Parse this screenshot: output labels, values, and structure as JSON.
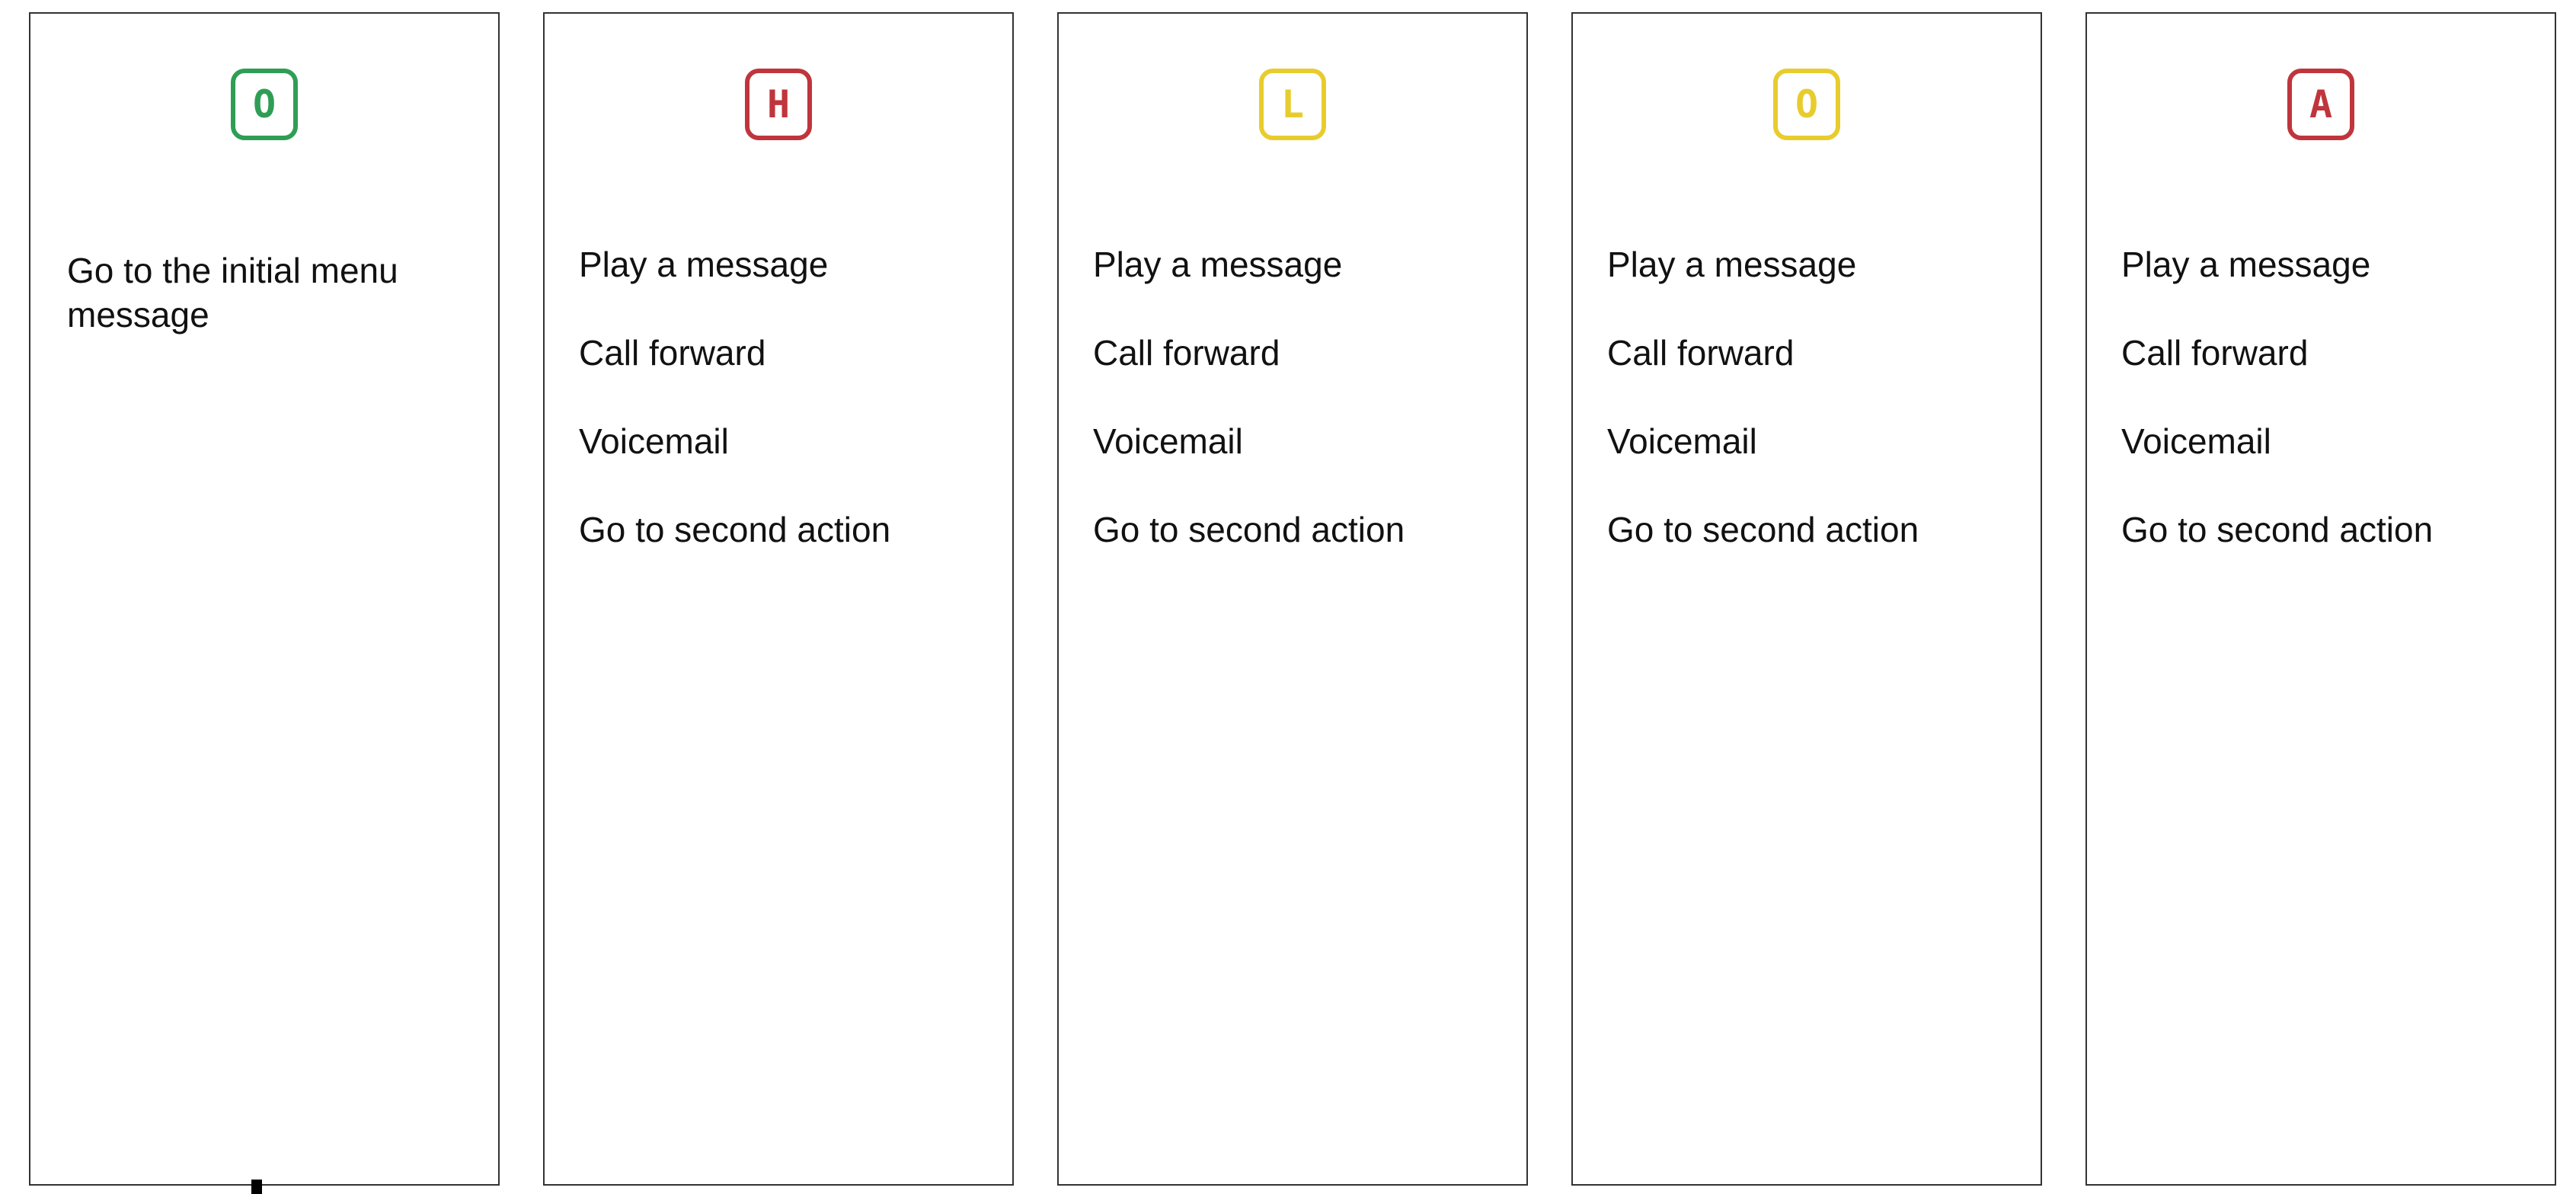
{
  "panels": [
    {
      "badge": {
        "letter": "O",
        "color": "#2f9e55"
      },
      "actions": [
        "Go to the initial menu message"
      ]
    },
    {
      "badge": {
        "letter": "H",
        "color": "#c0353c"
      },
      "actions": [
        "Play a message",
        "Call forward",
        "Voicemail",
        "Go to second action"
      ]
    },
    {
      "badge": {
        "letter": "L",
        "color": "#e8cc2e"
      },
      "actions": [
        "Play a message",
        "Call forward",
        "Voicemail",
        "Go to second action"
      ]
    },
    {
      "badge": {
        "letter": "O",
        "color": "#e8cc2e"
      },
      "actions": [
        "Play a message",
        "Call forward",
        "Voicemail",
        "Go to second action"
      ]
    },
    {
      "badge": {
        "letter": "A",
        "color": "#c0353c"
      },
      "actions": [
        "Play a message",
        "Call forward",
        "Voicemail",
        "Go to second action"
      ]
    }
  ]
}
